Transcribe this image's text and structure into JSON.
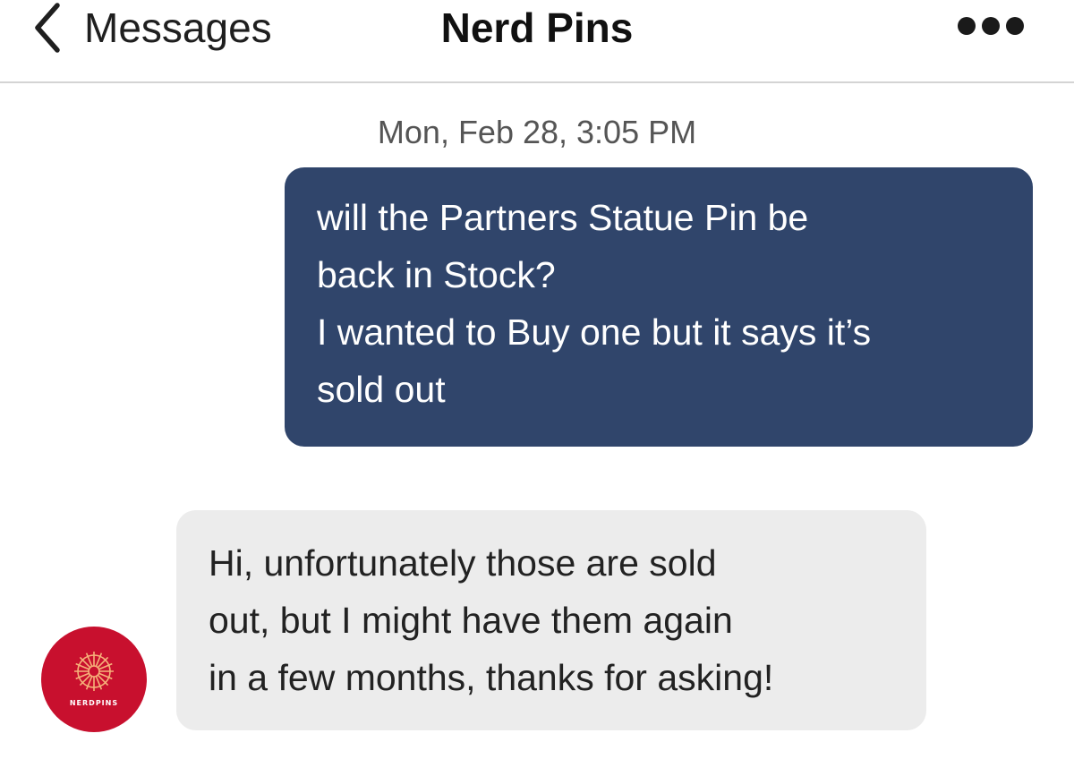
{
  "header": {
    "back_label": "Messages",
    "title": "Nerd Pins",
    "back_icon": "chevron-left-icon",
    "more_icon": "ellipsis-icon"
  },
  "conversation": {
    "timestamp": "Mon, Feb 28, 3:05 PM",
    "messages": [
      {
        "direction": "outgoing",
        "lines": [
          "will the Partners Statue Pin be",
          "back in Stock?",
          "I wanted to Buy one but it says it’s",
          "sold out"
        ]
      },
      {
        "direction": "incoming",
        "lines": [
          "Hi, unfortunately those are sold",
          "out, but I might have them again",
          "in a few months, thanks for asking!"
        ],
        "avatar": {
          "text": "NERDPINS",
          "icon": "sunburst-logo-icon"
        }
      }
    ]
  },
  "colors": {
    "outgoing_bubble": "#30456b",
    "incoming_bubble": "#ececec",
    "avatar_bg": "#c8102e",
    "divider": "#d4d4d4"
  }
}
